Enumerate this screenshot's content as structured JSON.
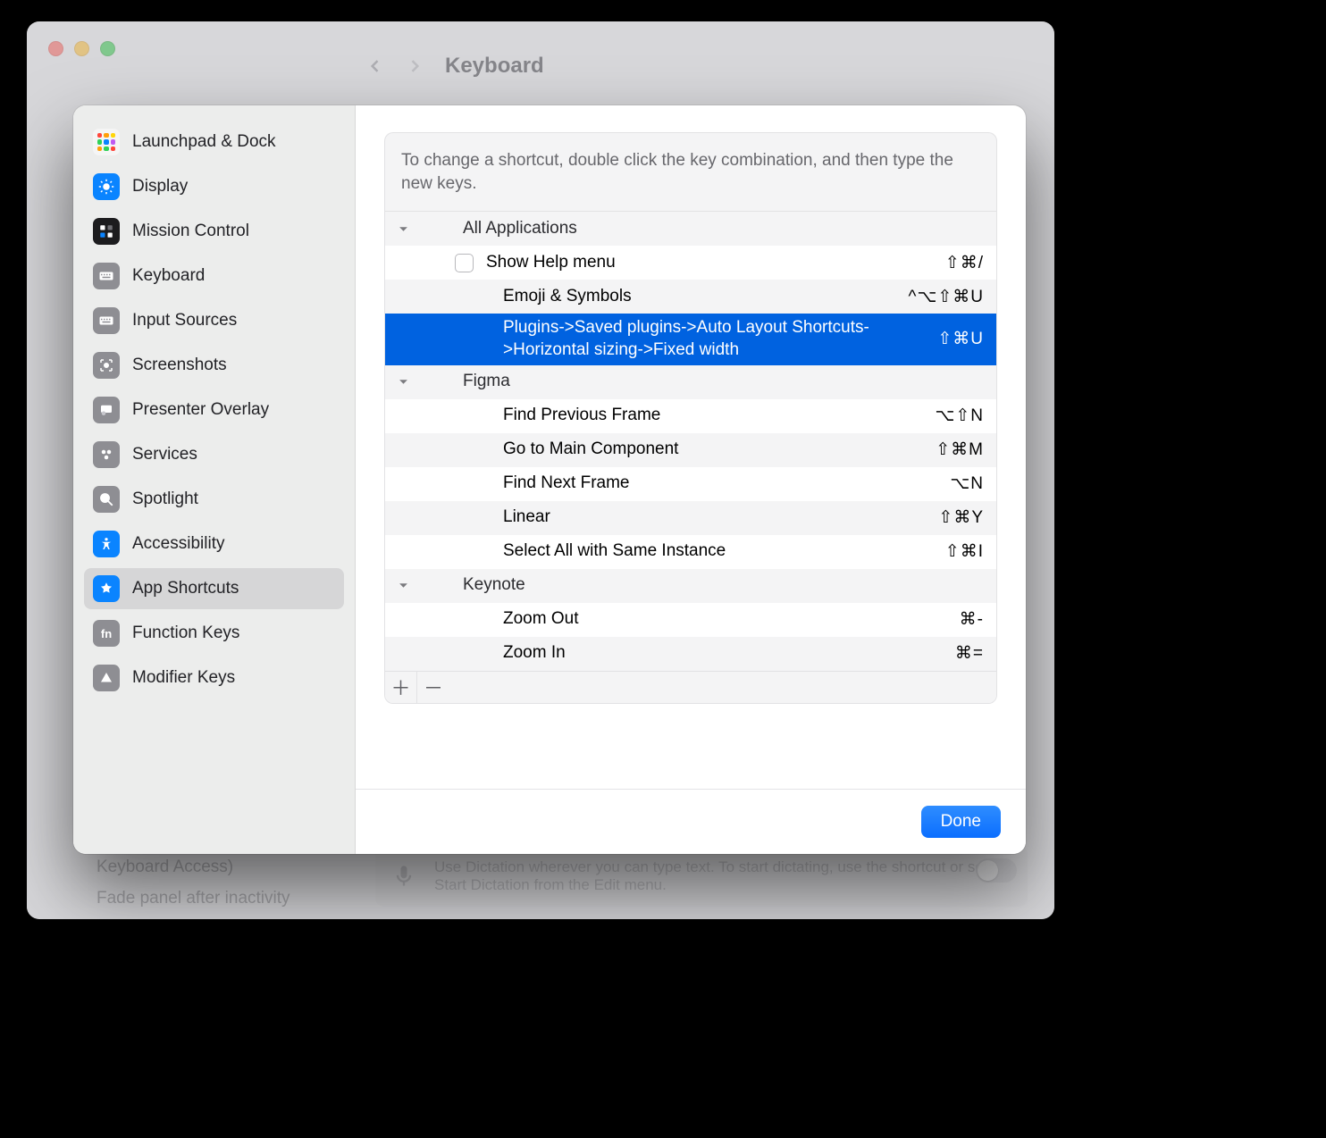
{
  "window": {
    "title": "Keyboard",
    "bg_text_1": "Color (Full\nKeyboard Access)",
    "bg_text_2": "Fade panel after inactivity",
    "dictation_hint": "Use Dictation wherever you can type text. To start dictating, use the shortcut or select Start Dictation from the Edit menu."
  },
  "sidebar": {
    "items": [
      {
        "label": "Launchpad & Dock",
        "icon": "launchpad"
      },
      {
        "label": "Display",
        "icon": "display"
      },
      {
        "label": "Mission Control",
        "icon": "mission"
      },
      {
        "label": "Keyboard",
        "icon": "keyboard"
      },
      {
        "label": "Input Sources",
        "icon": "input"
      },
      {
        "label": "Screenshots",
        "icon": "screenshot"
      },
      {
        "label": "Presenter Overlay",
        "icon": "presenter"
      },
      {
        "label": "Services",
        "icon": "services"
      },
      {
        "label": "Spotlight",
        "icon": "spotlight"
      },
      {
        "label": "Accessibility",
        "icon": "access"
      },
      {
        "label": "App Shortcuts",
        "icon": "appshortcut",
        "selected": true
      },
      {
        "label": "Function Keys",
        "icon": "fn"
      },
      {
        "label": "Modifier Keys",
        "icon": "modifier"
      }
    ]
  },
  "main": {
    "intro": "To change a shortcut, double click the key combination, and then type the new keys.",
    "done_label": "Done",
    "groups": [
      {
        "name": "All Applications",
        "expanded": true,
        "items": [
          {
            "label": "Show Help menu",
            "shortcut": "⇧⌘/",
            "checkbox": true
          },
          {
            "label": "Emoji & Symbols",
            "shortcut": "^⌥⇧⌘U"
          },
          {
            "label": "Plugins->Saved plugins->Auto Layout Shortcuts->Horizontal sizing->Fixed width",
            "shortcut": "⇧⌘U",
            "selected": true
          }
        ]
      },
      {
        "name": "Figma",
        "expanded": true,
        "items": [
          {
            "label": "Find Previous Frame",
            "shortcut": "⌥⇧N"
          },
          {
            "label": "Go to Main Component",
            "shortcut": "⇧⌘M"
          },
          {
            "label": "Find Next Frame",
            "shortcut": "⌥N"
          },
          {
            "label": "Linear",
            "shortcut": "⇧⌘Y"
          },
          {
            "label": "Select All with Same Instance",
            "shortcut": "⇧⌘I"
          }
        ]
      },
      {
        "name": "Keynote",
        "expanded": true,
        "items": [
          {
            "label": "Zoom Out",
            "shortcut": "⌘-"
          },
          {
            "label": "Zoom In",
            "shortcut": "⌘="
          }
        ]
      }
    ]
  }
}
